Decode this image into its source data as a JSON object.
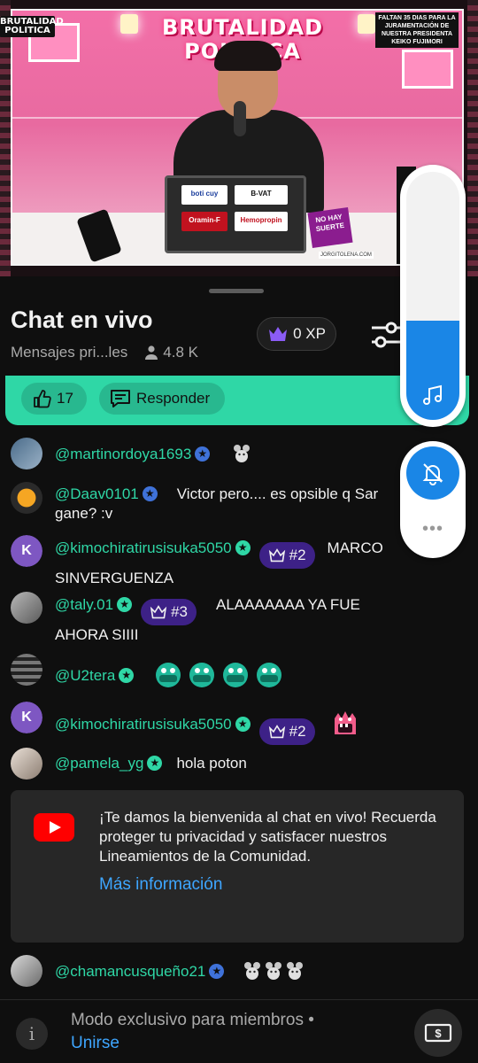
{
  "video": {
    "channel_logo": "BRUTALIDAD POLITICA",
    "sign_line1": "BRUTALIDAD",
    "sign_line2": "POLITICA",
    "notice": "FALTAN 35 DIAS PARA LA JURAMENTACIÓN DE NUESTRA PRESIDENTA KEIKO FUJIMORI",
    "sticker_1": "boti cuy",
    "sticker_2": "B-VAT",
    "sticker_3": "Oramin-F",
    "sticker_4": "Hemopropin",
    "stand_sign": "NO HAY SUERTE",
    "credit": "JORGITOLENA.COM"
  },
  "header": {
    "title": "Chat en vivo",
    "subtitle": "Mensajes pri...les",
    "viewers": "4.8 K",
    "xp": "0 XP"
  },
  "pinned": {
    "likes": "17",
    "reply_label": "Responder"
  },
  "messages": [
    {
      "author": "@martinordoya1693",
      "badge": "blue",
      "rank": "",
      "text": "",
      "emote": "mouse"
    },
    {
      "author": "@Daav0101",
      "badge": "blue",
      "rank": "",
      "text": "Victor pero.... es opsible q Sar gane? :v",
      "emote": ""
    },
    {
      "author": "@kimochiratirusisuka5050",
      "badge": "green",
      "rank": "#2",
      "text": "MARCO SINVERGUENZA",
      "emote": ""
    },
    {
      "author": "@taly.01",
      "badge": "green",
      "rank": "#3",
      "text": "ALAAAAAAA YA FUE AHORA SIIII",
      "emote": ""
    },
    {
      "author": "@U2tera",
      "badge": "green",
      "rank": "",
      "text": "",
      "emote": "pepe x4"
    },
    {
      "author": "@kimochiratirusisuka5050",
      "badge": "green",
      "rank": "#2",
      "text": "",
      "emote": "monster"
    },
    {
      "author": "@pamela_yg",
      "badge": "green",
      "rank": "",
      "text": "hola poton",
      "emote": ""
    },
    {
      "author": "@chamancusqueño21",
      "badge": "blue",
      "rank": "",
      "text": "",
      "emote": "mouse x3"
    }
  ],
  "avatar_letter": "K",
  "welcome": {
    "text": "¡Te damos la bienvenida al chat en vivo! Recuerda proteger tu privacidad y satisfacer nuestros Lineamientos de la Comunidad.",
    "link": "Más información"
  },
  "bottom": {
    "label": "Modo exclusivo para miembros  •",
    "join": "Unirse"
  },
  "colors": {
    "accent": "#2fd7a6",
    "link": "#3ea6ff",
    "rank_bg": "#3d2187",
    "widget_blue": "#1a86e6"
  }
}
